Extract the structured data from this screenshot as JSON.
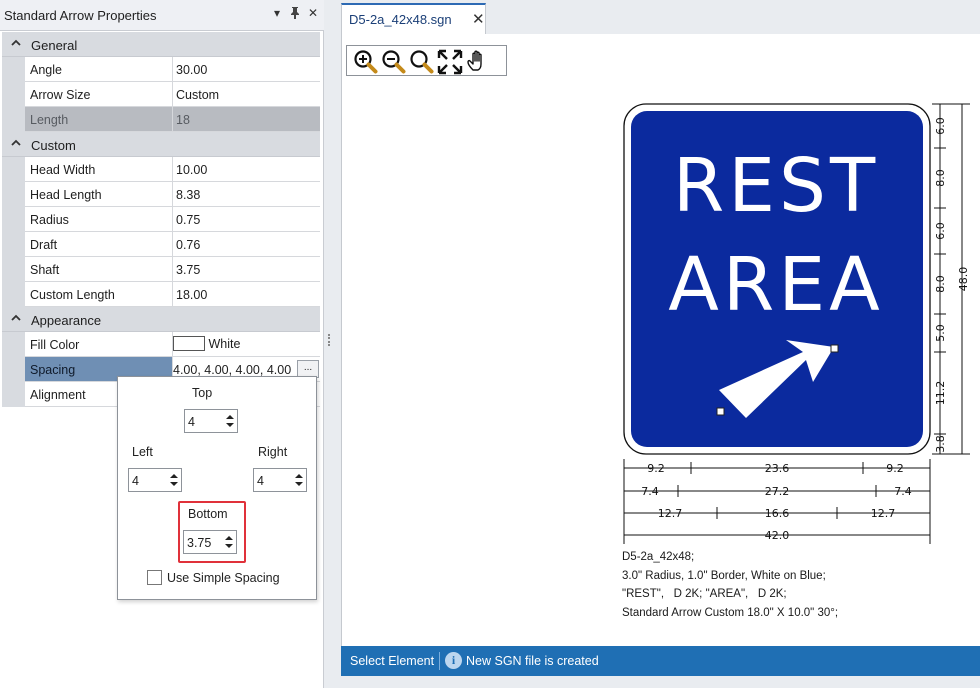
{
  "pane": {
    "title": "Standard Arrow Properties",
    "controls": [
      "▾",
      "📌",
      "✕"
    ]
  },
  "grid": {
    "general": {
      "label": "General",
      "rows": [
        {
          "name": "Angle",
          "value": "30.00"
        },
        {
          "name": "Arrow Size",
          "value": "Custom"
        },
        {
          "name": "Length",
          "value": "18"
        }
      ]
    },
    "custom": {
      "label": "Custom",
      "rows": [
        {
          "name": "Head Width",
          "value": "10.00"
        },
        {
          "name": "Head Length",
          "value": "8.38"
        },
        {
          "name": "Radius",
          "value": "0.75"
        },
        {
          "name": "Draft",
          "value": "0.76"
        },
        {
          "name": "Shaft",
          "value": "3.75"
        },
        {
          "name": "Custom Length",
          "value": "18.00"
        }
      ]
    },
    "appearance": {
      "label": "Appearance",
      "fill_color": {
        "name": "Fill Color",
        "value": "White"
      },
      "spacing": {
        "name": "Spacing",
        "value": "4.00, 4.00, 4.00, 4.00",
        "button": "..."
      },
      "alignment": {
        "name": "Alignment",
        "value": ""
      }
    }
  },
  "spacing_popup": {
    "top_label": "Top",
    "top_value": "4",
    "left_label": "Left",
    "left_value": "4",
    "right_label": "Right",
    "right_value": "4",
    "bottom_label": "Bottom",
    "bottom_value": "3.75",
    "simple_spacing_label": "Use Simple Spacing",
    "simple_spacing_checked": false
  },
  "document": {
    "tab_title": "D5-2a_42x48.sgn",
    "tab_close": "✕",
    "zoom_tools": [
      "zoom-in-icon",
      "zoom-out-icon",
      "zoom-window-icon",
      "zoom-extents-icon",
      "pan-hand-icon"
    ]
  },
  "sign": {
    "line1": "REST",
    "line2": "AREA",
    "background_color": "#0b2a9e",
    "legend_color": "#ffffff",
    "right_dims": [
      "6.0",
      "8.0",
      "6.0",
      "8.0",
      "5.0",
      "11.2",
      "3.8"
    ],
    "total_height": "48.0",
    "row1_dims": [
      "9.2",
      "23.6",
      "9.2"
    ],
    "row2_dims": [
      "7.4",
      "27.2",
      "7.4"
    ],
    "row3_dims": [
      "12.7",
      "16.6",
      "12.7"
    ],
    "total_width": "42.0",
    "description": [
      "D5-2a_42x48;",
      "3.0\" Radius, 1.0\" Border, White on Blue;",
      "\"REST\",   D 2K; \"AREA\",   D 2K;",
      "Standard Arrow Custom 18.0\" X 10.0\" 30°;"
    ]
  },
  "status": {
    "mode": "Select Element",
    "info_glyph": "i",
    "message": "New SGN file is created"
  },
  "colors": {
    "accent": "#2d6ab4",
    "statusbar": "#1f6fb4",
    "highlight": "#e0313a",
    "selected_row": "#6f8fb4"
  }
}
